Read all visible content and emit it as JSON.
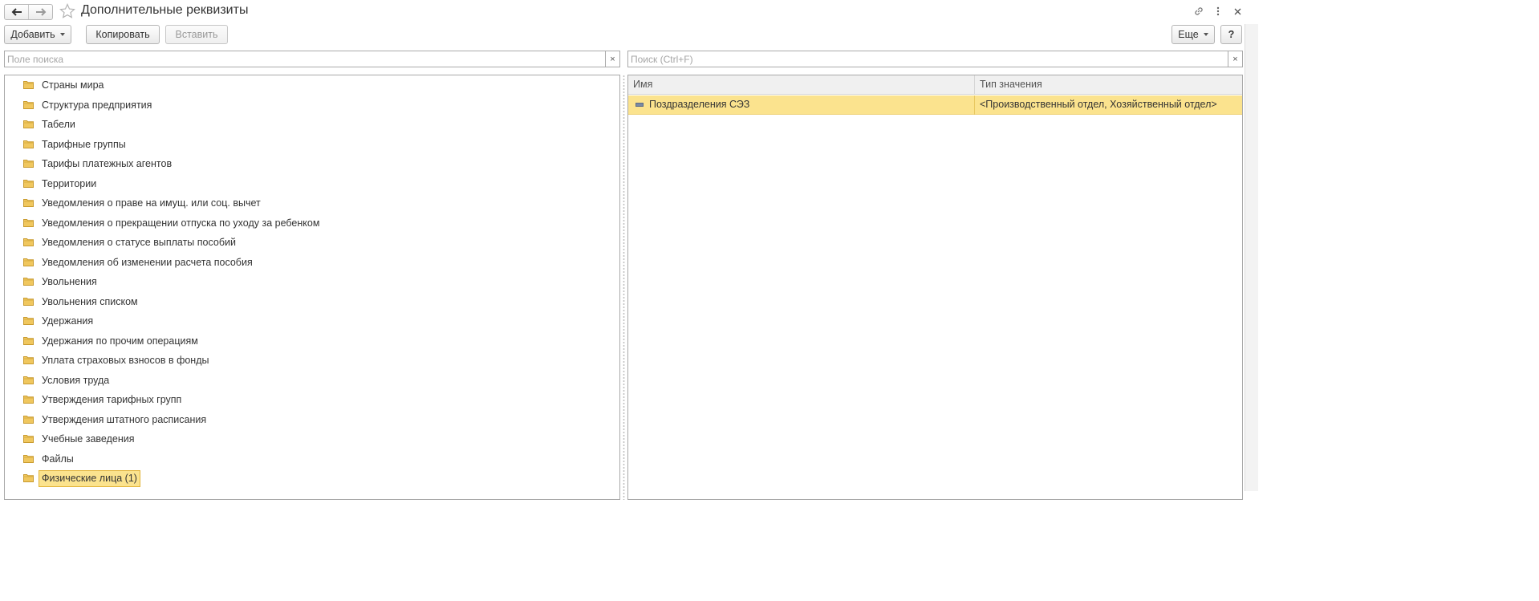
{
  "window": {
    "title": "Дополнительные реквизиты",
    "icons": [
      "back-arrow-icon",
      "forward-arrow-icon",
      "favorite-star-icon",
      "link-icon",
      "more-vertical-icon",
      "close-icon"
    ]
  },
  "toolbar": {
    "add_label": "Добавить",
    "copy_label": "Копировать",
    "paste_label": "Вставить",
    "more_label": "Еще",
    "help_label": "?"
  },
  "left_search": {
    "placeholder": "Поле поиска",
    "value": "",
    "clear_label": "×"
  },
  "right_search": {
    "placeholder": "Поиск (Ctrl+F)",
    "value": "",
    "clear_label": "×"
  },
  "tree": {
    "items": [
      {
        "label": "Страны мира"
      },
      {
        "label": "Структура предприятия"
      },
      {
        "label": "Табели"
      },
      {
        "label": "Тарифные группы"
      },
      {
        "label": "Тарифы платежных агентов"
      },
      {
        "label": "Территории"
      },
      {
        "label": "Уведомления о праве на имущ. или соц. вычет"
      },
      {
        "label": "Уведомления о прекращении отпуска по уходу за ребенком"
      },
      {
        "label": "Уведомления о статусе выплаты пособий"
      },
      {
        "label": "Уведомления об изменении расчета пособия"
      },
      {
        "label": "Увольнения"
      },
      {
        "label": "Увольнения списком"
      },
      {
        "label": "Удержания"
      },
      {
        "label": "Удержания по прочим операциям"
      },
      {
        "label": "Уплата страховых взносов в фонды"
      },
      {
        "label": "Условия труда"
      },
      {
        "label": "Утверждения тарифных групп"
      },
      {
        "label": "Утверждения штатного расписания"
      },
      {
        "label": "Учебные заведения"
      },
      {
        "label": "Файлы"
      },
      {
        "label": "Физические лица (1)",
        "selected": true
      }
    ]
  },
  "grid": {
    "columns": [
      "Имя",
      "Тип значения"
    ],
    "rows": [
      {
        "name": "Поздразделения СЭЗ",
        "type": "<Производственный отдел, Хозяйственный отдел>"
      }
    ]
  },
  "colors": {
    "selection": "#fbe38e",
    "selection_border": "#e2b43a",
    "folder": "#f0c75e"
  }
}
